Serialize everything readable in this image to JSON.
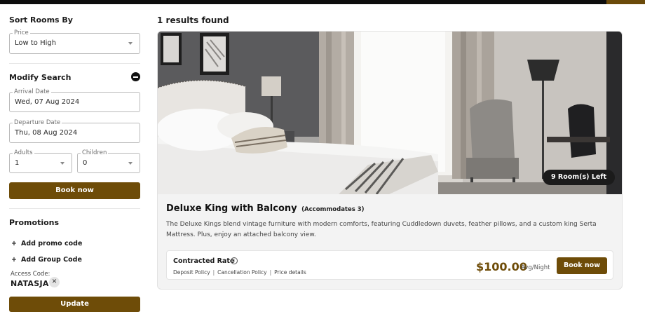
{
  "sidebar": {
    "sort_title": "Sort Rooms By",
    "sort_field": {
      "legend": "Price",
      "value": "Low to High"
    },
    "modify_title": "Modify Search",
    "arrival": {
      "legend": "Arrival Date",
      "value": "Wed, 07 Aug 2024"
    },
    "departure": {
      "legend": "Departure Date",
      "value": "Thu, 08 Aug 2024"
    },
    "adults": {
      "legend": "Adults",
      "value": "1"
    },
    "children": {
      "legend": "Children",
      "value": "0"
    },
    "book_now": "Book now",
    "promotions_title": "Promotions",
    "add_promo": "Add promo code",
    "add_group": "Add Group Code",
    "plus_glyph": "+",
    "access_label": "Access Code:",
    "access_code": "NATASJA",
    "remove_glyph": "✕",
    "update": "Update"
  },
  "main": {
    "results_text": "1 results found",
    "room": {
      "rooms_left": "9 Room(s) Left",
      "title": "Deluxe King with Balcony",
      "accommodates": "(Accommodates 3)",
      "description": "The Deluxe Kings blend vintage furniture with modern comforts, featuring Cuddledown duvets, feather pillows, and a custom king Serta Mattress. Plus, enjoy an attached balcony view.",
      "rate": {
        "name": "Contracted Rate",
        "info_glyph": "i",
        "policies": [
          "Deposit Policy",
          "Cancellation Policy",
          "Price details"
        ],
        "separator": "|",
        "price": "$100.00",
        "per": "Avg/Night",
        "book_label": "Book now"
      }
    }
  },
  "colors": {
    "accent": "#6e4c08",
    "topbar": "#0d0d0d",
    "badge": "#1b1b1b"
  }
}
